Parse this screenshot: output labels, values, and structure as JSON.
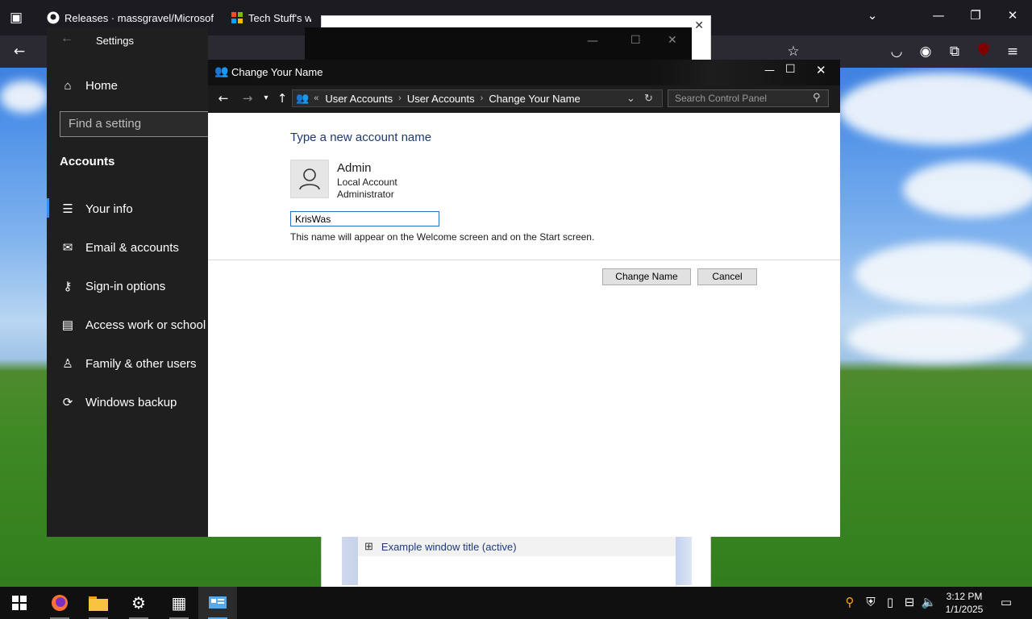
{
  "browser": {
    "tabs": [
      {
        "label": "Releases · massgravel/Microsof",
        "close": "✕"
      },
      {
        "label": "Tech Stuff's websi",
        "close": ""
      }
    ]
  },
  "bg_window": {
    "example_title": "Example window title (active)"
  },
  "settings": {
    "title": "Settings",
    "search_placeholder": "Find a setting",
    "home_label": "Home",
    "section": "Accounts",
    "items": [
      {
        "label": "Your info",
        "icon": "person-list-icon"
      },
      {
        "label": "Email & accounts",
        "icon": "mail-icon"
      },
      {
        "label": "Sign-in options",
        "icon": "key-icon"
      },
      {
        "label": "Access work or school",
        "icon": "briefcase-icon"
      },
      {
        "label": "Family & other users",
        "icon": "person-add-icon"
      },
      {
        "label": "Windows backup",
        "icon": "sync-icon"
      }
    ]
  },
  "dialog": {
    "title": "Change Your Name",
    "breadcrumb": [
      "User Accounts",
      "User Accounts",
      "Change Your Name"
    ],
    "search_placeholder": "Search Control Panel",
    "heading": "Type a new account name",
    "account_name": "Admin",
    "account_type": "Local Account",
    "account_role": "Administrator",
    "new_name_value": "KrisWas",
    "hint": "This name will appear on the Welcome screen and on the Start screen.",
    "primary_button": "Change Name",
    "cancel_button": "Cancel"
  },
  "taskbar": {
    "time": "3:12 PM",
    "date": "1/1/2025"
  }
}
